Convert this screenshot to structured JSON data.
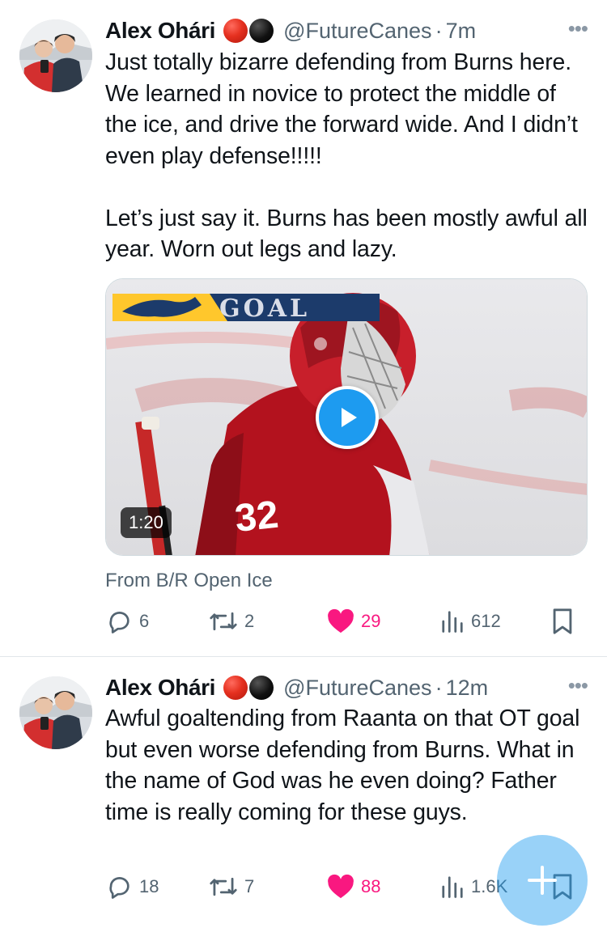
{
  "tweets": [
    {
      "author_name": "Alex Ohári",
      "handle": "@FutureCanes",
      "separator": "·",
      "time": "7m",
      "more": "•••",
      "text": "Just totally bizarre defending from Burns here. We learned in novice to protect the middle of the ice, and drive the forward wide. And I didn’t even play defense!!!!!\n\nLet’s just say it. Burns has been mostly awful all year. Worn out legs and lazy.",
      "media": {
        "overlay_text": "GOAL",
        "jersey_number": "32",
        "duration": "1:20",
        "source": "From B/R Open Ice"
      },
      "replies": "6",
      "retweets": "2",
      "likes": "29",
      "views": "612"
    },
    {
      "author_name": "Alex Ohári",
      "handle": "@FutureCanes",
      "separator": "·",
      "time": "12m",
      "more": "•••",
      "text": "Awful goaltending from Raanta on that OT goal but even worse defending from Burns. What in the name of God was he even doing? Father time is really coming for these guys.",
      "replies": "18",
      "retweets": "7",
      "likes": "88",
      "views": "1.6K"
    }
  ],
  "colors": {
    "accent": "#1d9bf0",
    "like": "#f91880",
    "muted": "#536471"
  },
  "icons": [
    "reply-icon",
    "retweet-icon",
    "heart-icon",
    "views-icon",
    "bookmark-icon",
    "play-icon",
    "compose-plus-icon",
    "more-icon"
  ]
}
